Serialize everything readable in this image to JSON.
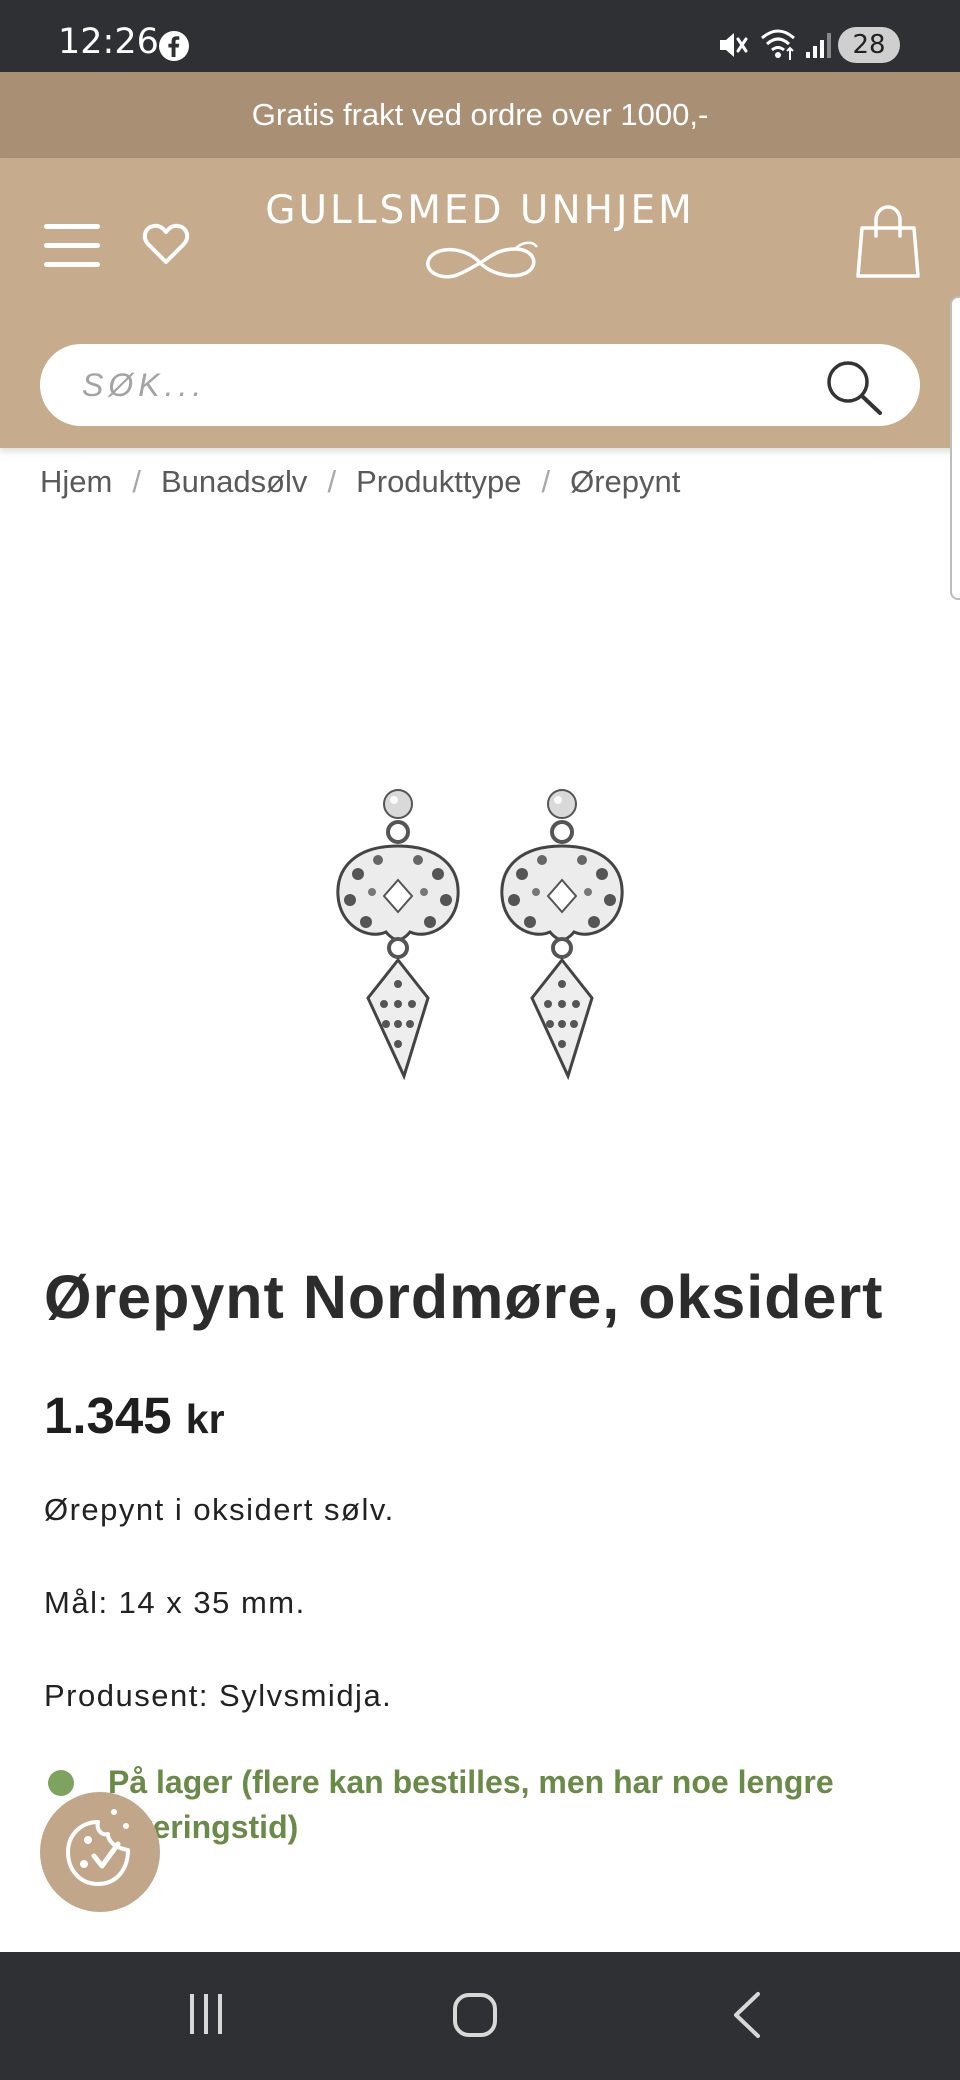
{
  "status_bar": {
    "time": "12:26",
    "notification_icon": "facebook-icon",
    "battery_level": "28",
    "icons": [
      "mute-icon",
      "wifi-icon",
      "signal-icon"
    ]
  },
  "promo": {
    "text": "Gratis frakt ved ordre over 1000,-"
  },
  "header": {
    "logo_text": "GULLSMED UNHJEM",
    "background_color": "#c7ab8d",
    "icons": [
      "menu-icon",
      "heart-icon",
      "shopping-bag-icon"
    ]
  },
  "search": {
    "placeholder": "SØK...",
    "value": ""
  },
  "breadcrumb": [
    "Hjem",
    "Bunadsølv",
    "Produkttype",
    "Ørepynt"
  ],
  "product": {
    "title": "Ørepynt Nordmøre, oksidert",
    "price_amount": "1.345",
    "price_currency": "kr",
    "description": [
      "Ørepynt i oksidert sølv.",
      "Mål: 14 x 35 mm.",
      "Produsent: Sylvsmidja."
    ],
    "stock_status": "På lager (flere kan bestilles, men har noe lengre leveringstid)",
    "stock_color": "#6a8a47"
  },
  "cookie_button": {
    "icon": "cookie-consent-icon"
  },
  "nav_bar": {
    "icons": [
      "recent-apps-icon",
      "home-icon",
      "back-icon"
    ]
  }
}
